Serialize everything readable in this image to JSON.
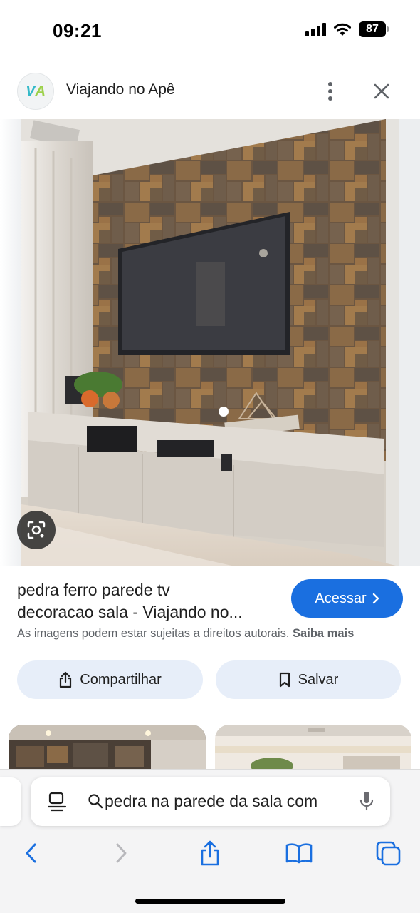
{
  "status_bar": {
    "time": "09:21",
    "battery": "87"
  },
  "header": {
    "site_logo_text": "VA",
    "site_name": "Viajando no Apê"
  },
  "result": {
    "title_line1": "pedra ferro parede tv",
    "title_line2": "decoracao sala - Viajando no...",
    "visit_label": "Acessar",
    "copyright_text": "As imagens podem estar sujeitas a direitos autorais.",
    "learn_more": "Saiba mais"
  },
  "actions": {
    "share_label": "Compartilhar",
    "save_label": "Salvar"
  },
  "browser": {
    "address_text": "pedra na parede da sala com"
  },
  "colors": {
    "accent": "#1a6fe0",
    "action_bg": "#e7eef9",
    "toolbar_icon": "#1a6fe0"
  }
}
